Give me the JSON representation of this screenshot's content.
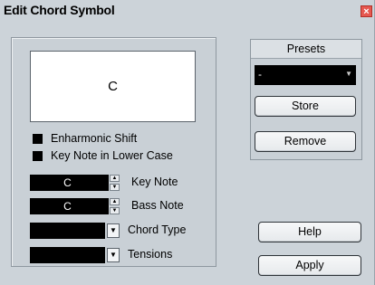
{
  "window": {
    "title": "Edit Chord Symbol",
    "close_glyph": "×"
  },
  "preview": {
    "chord": "C"
  },
  "options": [
    {
      "label": "Enharmonic Shift",
      "checked": true
    },
    {
      "label": "Key Note in Lower Case",
      "checked": true
    }
  ],
  "fields": {
    "key_note": {
      "value": "C",
      "label": "Key Note"
    },
    "bass_note": {
      "value": "C",
      "label": "Bass Note"
    },
    "chord_type": {
      "value": "",
      "label": "Chord Type"
    },
    "tensions": {
      "value": "",
      "label": "Tensions"
    }
  },
  "presets": {
    "header": "Presets",
    "selected": "-",
    "store_label": "Store",
    "remove_label": "Remove"
  },
  "buttons": {
    "help_label": "Help",
    "apply_label": "Apply"
  },
  "icons": {
    "close": "close-icon",
    "spin_up": "arrow-up-icon",
    "spin_down": "arrow-down-icon",
    "dropdown": "chevron-down-icon"
  },
  "colors": {
    "dialog_bg": "#ccd3d9",
    "close_red": "#e65850",
    "field_bg": "#000000"
  }
}
